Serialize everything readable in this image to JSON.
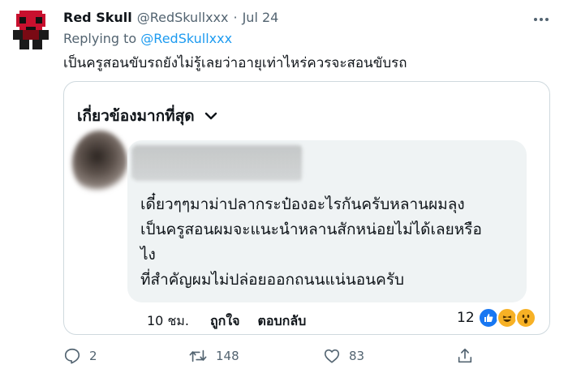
{
  "tweet": {
    "display_name": "Red Skull",
    "handle": "@RedSkullxxx",
    "separator": "·",
    "date": "Jul 24",
    "replying_label": "Replying to",
    "replying_handle": "@RedSkullxxx",
    "text": "เป็นครูสอนขับรถยังไม่รู้เลยว่าอายุเท่าไหร่ควรจะสอนขับรถ"
  },
  "embedded": {
    "sort_label": "เกี่ยวข้องมากที่สุด",
    "comment_lines": [
      "เดี๋ยวๆๆมาม่าปลากระป๋องอะไรกันครับหลานผมลุง",
      "เป็นครูสอนผมจะแนะนำหลานสักหน่อยไม่ได้เลยหรือ",
      "ไง",
      "ที่สำคัญผมไม่ปล่อยออกถนนแน่นอนครับ"
    ],
    "time": "10 ชม.",
    "like_label": "ถูกใจ",
    "reply_label": "ตอบกลับ",
    "reaction_count": "12",
    "reactions": [
      "like-icon",
      "haha-icon",
      "wow-icon"
    ]
  },
  "actions": {
    "reply_count": "2",
    "retweet_count": "148",
    "like_count": "83"
  },
  "colors": {
    "accent": "#1d9bf0",
    "muted": "#536471",
    "avatar_red": "#c8102e"
  }
}
